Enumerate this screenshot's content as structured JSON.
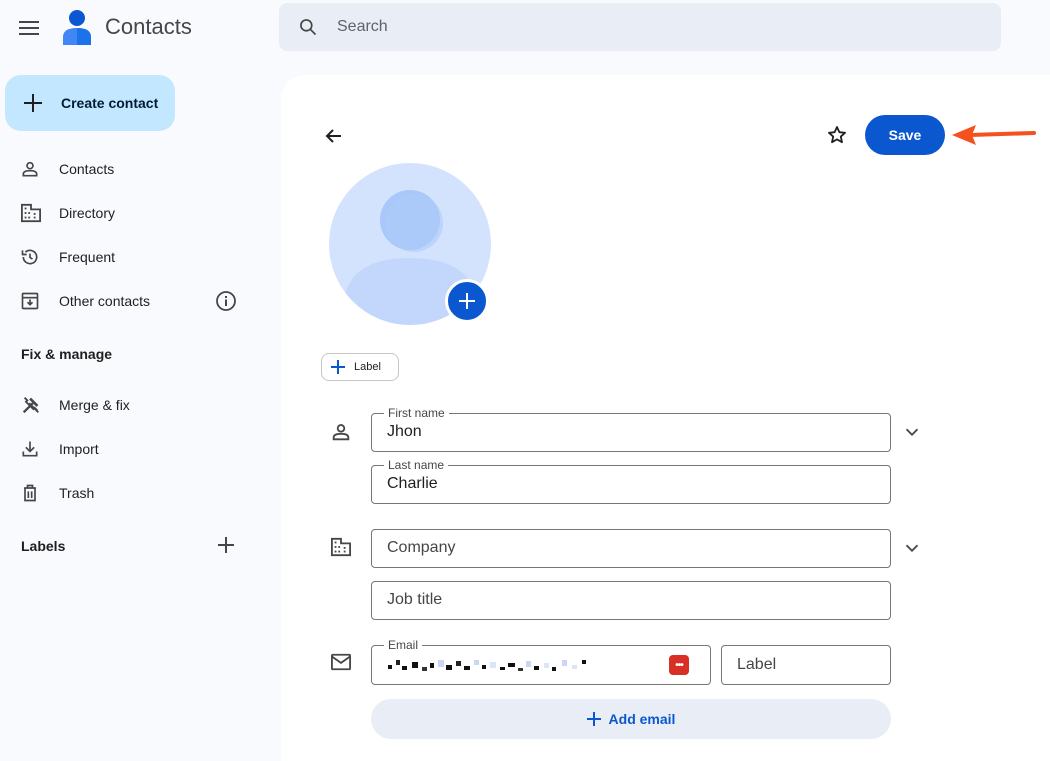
{
  "app": {
    "title": "Contacts"
  },
  "search": {
    "placeholder": "Search"
  },
  "sidebar": {
    "create_label": "Create contact",
    "items": [
      {
        "label": "Contacts",
        "icon": "person-icon"
      },
      {
        "label": "Directory",
        "icon": "domain-icon"
      },
      {
        "label": "Frequent",
        "icon": "history-icon"
      },
      {
        "label": "Other contacts",
        "icon": "archive-icon"
      }
    ],
    "fix_manage_heading": "Fix & manage",
    "fix_items": [
      {
        "label": "Merge & fix",
        "icon": "tools-icon"
      },
      {
        "label": "Import",
        "icon": "download-icon"
      },
      {
        "label": "Trash",
        "icon": "trash-icon"
      }
    ],
    "labels_heading": "Labels"
  },
  "editor": {
    "save_label": "Save",
    "label_chip": "Label",
    "first_name": {
      "label": "First name",
      "value": "Jhon"
    },
    "last_name": {
      "label": "Last name",
      "value": "Charlie"
    },
    "company": {
      "placeholder": "Company"
    },
    "job_title": {
      "placeholder": "Job title"
    },
    "email": {
      "label": "Email"
    },
    "email_label": {
      "placeholder": "Label"
    },
    "add_email_label": "Add email"
  },
  "colors": {
    "accent": "#0b57d0",
    "create_bg": "#c2e7ff",
    "search_bg": "#e9eef6",
    "annotation_arrow": "#f4511e"
  }
}
